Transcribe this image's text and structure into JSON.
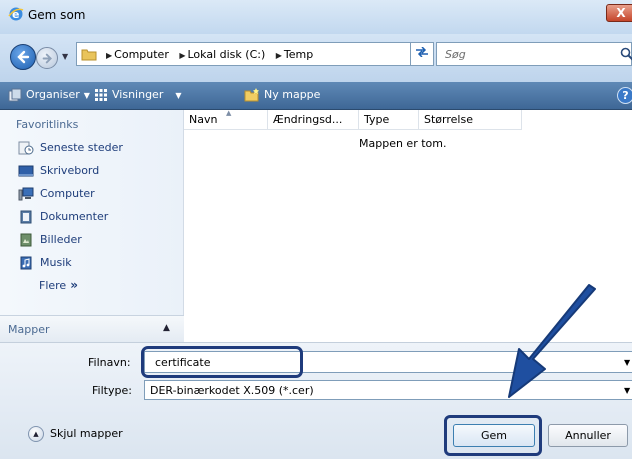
{
  "window": {
    "title": "Gem som",
    "close_glyph": "X"
  },
  "address": {
    "crumbs": [
      "Computer",
      "Lokal disk (C:)",
      "Temp"
    ],
    "search_placeholder": "Søg"
  },
  "toolbar": {
    "organize_label": "Organiser",
    "views_label": "Visninger",
    "new_folder_label": "Ny mappe",
    "help_glyph": "?"
  },
  "sidebar": {
    "header": "Favoritlinks",
    "items": [
      {
        "label": "Seneste steder",
        "icon": "recent-places-icon"
      },
      {
        "label": "Skrivebord",
        "icon": "desktop-icon"
      },
      {
        "label": "Computer",
        "icon": "computer-icon"
      },
      {
        "label": "Dokumenter",
        "icon": "documents-icon"
      },
      {
        "label": "Billeder",
        "icon": "pictures-icon"
      },
      {
        "label": "Musik",
        "icon": "music-icon"
      }
    ],
    "more_label": "Flere",
    "more_glyph": "»",
    "folders_label": "Mapper"
  },
  "filelist": {
    "columns": [
      "Navn",
      "Ændringsd...",
      "Type",
      "Størrelse"
    ],
    "empty_message": "Mappen er tom."
  },
  "form": {
    "filename_label": "Filnavn:",
    "filename_value": "certificate",
    "filetype_label": "Filtype:",
    "filetype_value": "DER-binærkodet X.509 (*.cer)"
  },
  "footer": {
    "hide_folders_label": "Skjul mapper",
    "save_label": "Gem",
    "cancel_label": "Annuller"
  },
  "colors": {
    "highlight": "#1f3b7c",
    "arrow": "#1f4fa0",
    "toolbar": "#4f78a6"
  }
}
